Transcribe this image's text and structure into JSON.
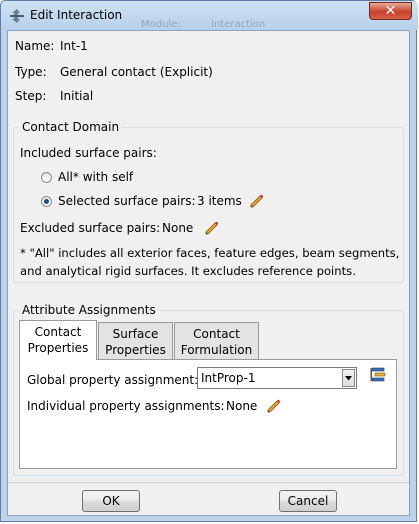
{
  "window": {
    "title": "Edit Interaction",
    "background_menu": [
      "Module:",
      "Interaction"
    ],
    "close_label": "✕"
  },
  "info": {
    "name_label": "Name:",
    "name_value": "Int-1",
    "type_label": "Type:",
    "type_value": "General contact (Explicit)",
    "step_label": "Step:",
    "step_value": "Initial"
  },
  "contact_domain": {
    "title": "Contact Domain",
    "included_label": "Included surface pairs:",
    "option_all": "All* with self",
    "option_selected": "Selected surface pairs:",
    "selected_count": "3 items",
    "selected_option": "selected",
    "excluded_label": "Excluded surface pairs:",
    "excluded_value": "None",
    "note_line1": "* \"All\" includes all exterior faces, feature edges, beam segments,",
    "note_line2": "and analytical rigid surfaces. It excludes reference points."
  },
  "attribute_assignments": {
    "title": "Attribute Assignments",
    "tabs": [
      {
        "line1": "Contact",
        "line2": "Properties",
        "active": true
      },
      {
        "line1": "Surface",
        "line2": "Properties",
        "active": false
      },
      {
        "line1": "Contact",
        "line2": "Formulation",
        "active": false
      }
    ],
    "global_label": "Global property assignment:",
    "global_value": "IntProp-1",
    "individual_label": "Individual property assignments:",
    "individual_value": "None"
  },
  "buttons": {
    "ok": "OK",
    "cancel": "Cancel"
  },
  "icons": [
    "edit-interaction-icon",
    "pencil-icon",
    "dropdown-arrow-icon",
    "property-manager-icon",
    "close-icon"
  ],
  "colors": {
    "titlebar": "#bcd3ea",
    "close_button": "#c7422c",
    "dialog_bg": "#f0f0f0",
    "radio_dot": "#1d4e89",
    "pencil": "#e8a23a"
  }
}
